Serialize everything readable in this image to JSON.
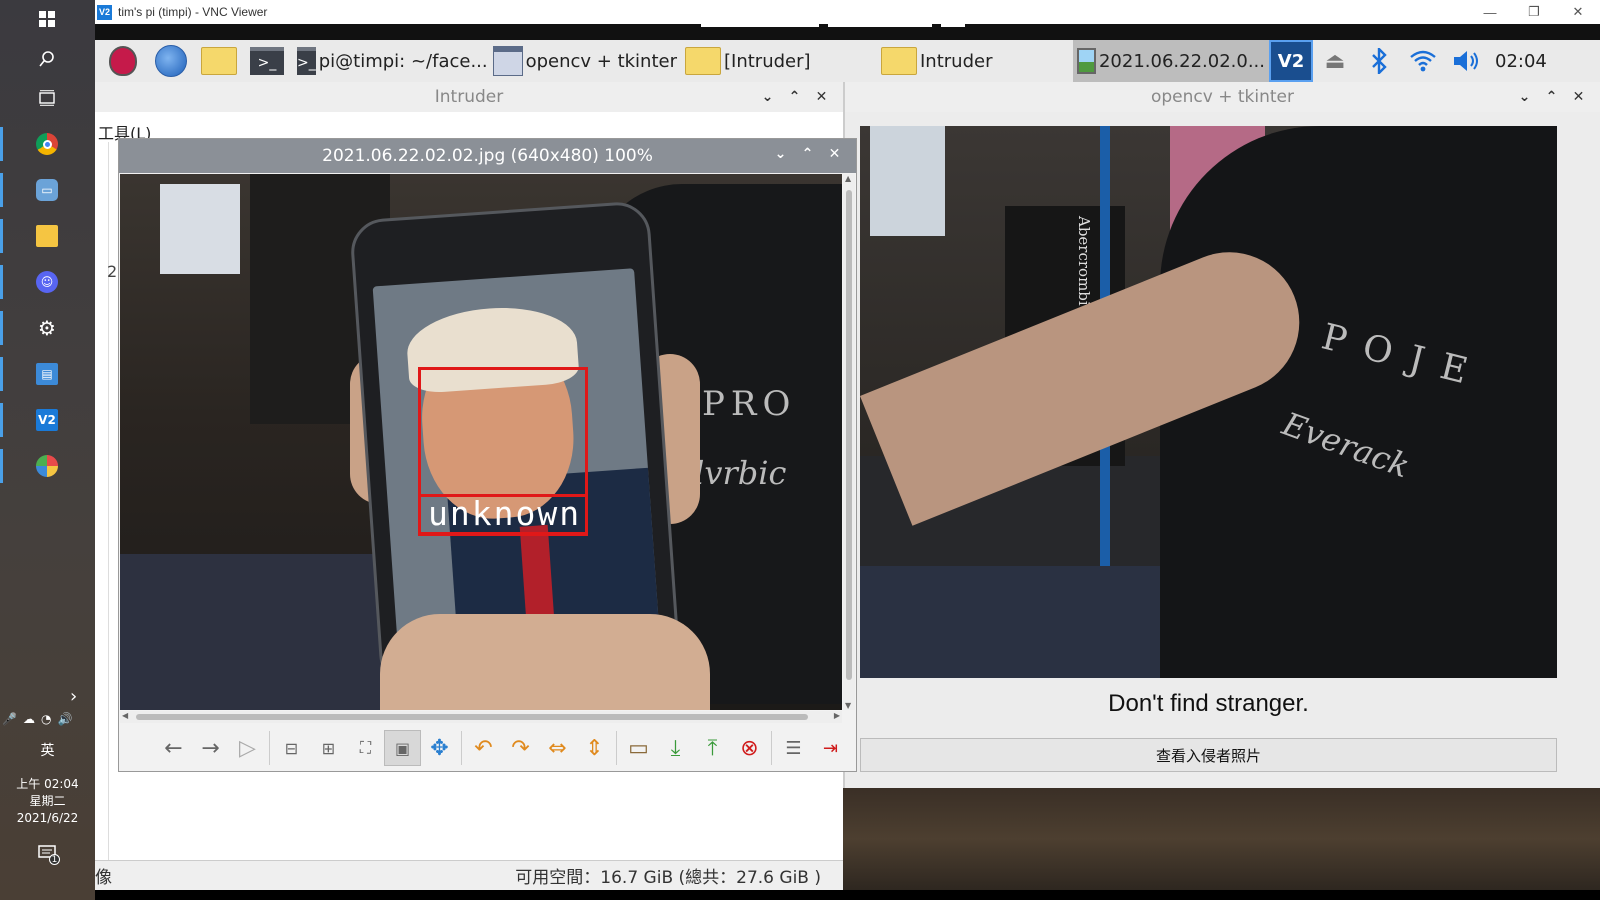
{
  "vnc": {
    "title": "tim's pi (timpi) - VNC Viewer",
    "logo": "V2",
    "controls": [
      "—",
      "❐",
      "✕"
    ]
  },
  "windows_taskbar": {
    "clock_line1": "上午 02:04",
    "clock_line2": "星期二",
    "clock_line3": "2021/6/22",
    "ime": "英",
    "chevron": "›",
    "notification_count": "1",
    "icons": [
      "windows-start-icon",
      "search-icon",
      "task-view-icon",
      "chrome-icon",
      "remote-desktop-icon",
      "file-explorer-icon",
      "discord-icon",
      "settings-icon",
      "remote-app-icon",
      "vnc-viewer-icon",
      "paint-icon"
    ]
  },
  "pi_panel": {
    "tasks": [
      {
        "label": "pi@timpi: ~/face...",
        "icon": "terminal-icon"
      },
      {
        "label": "opencv + tkinter",
        "icon": "window-icon"
      },
      {
        "label": "[Intruder]",
        "icon": "folder-icon"
      },
      {
        "label": "Intruder",
        "icon": "folder-icon"
      },
      {
        "label": "2021.06.22.02.0...",
        "icon": "image-icon"
      }
    ],
    "active_task": 4,
    "vnc_tray_label": "V2",
    "clock": "02:04",
    "tray_icons": [
      "vnc-server-icon",
      "eject-icon",
      "bluetooth-icon",
      "wifi-icon",
      "volume-icon"
    ]
  },
  "intruder_window": {
    "title": "Intruder",
    "menu": "工具(L)",
    "partial_text": "2",
    "status_left": "像",
    "status_right": "可用空間：16.7 GiB (總共：27.6 GiB )"
  },
  "viewer_window": {
    "title": "2021.06.22.02.02.jpg (640x480) 100%",
    "face_label": "unknown",
    "shirt_text_1": "PRO",
    "shirt_text_2": "Silvrbic",
    "toolbar": [
      "prev-icon",
      "next-icon",
      "slideshow-icon",
      "zoom-out-icon",
      "zoom-in-icon",
      "zoom-fit-icon",
      "zoom-original-icon",
      "fullscreen-icon",
      "rotate-left-icon",
      "rotate-right-icon",
      "flip-horizontal-icon",
      "flip-vertical-icon",
      "open-file-icon",
      "save-icon",
      "save-as-icon",
      "delete-icon",
      "preferences-icon",
      "quit-icon"
    ],
    "pressed_tool": "zoom-original-icon"
  },
  "opencv_window": {
    "title": "opencv + tkinter",
    "message": "Don't find stranger.",
    "button_label": "查看入侵者照片",
    "jacket_text": "Abercrombie",
    "shirt_text_1": "POJE",
    "shirt_text_2": "Everack"
  },
  "colors": {
    "face_box": "#e01818",
    "vnc_accent": "#1a7ad8",
    "pi_panel_bg": "#eaeaea"
  }
}
